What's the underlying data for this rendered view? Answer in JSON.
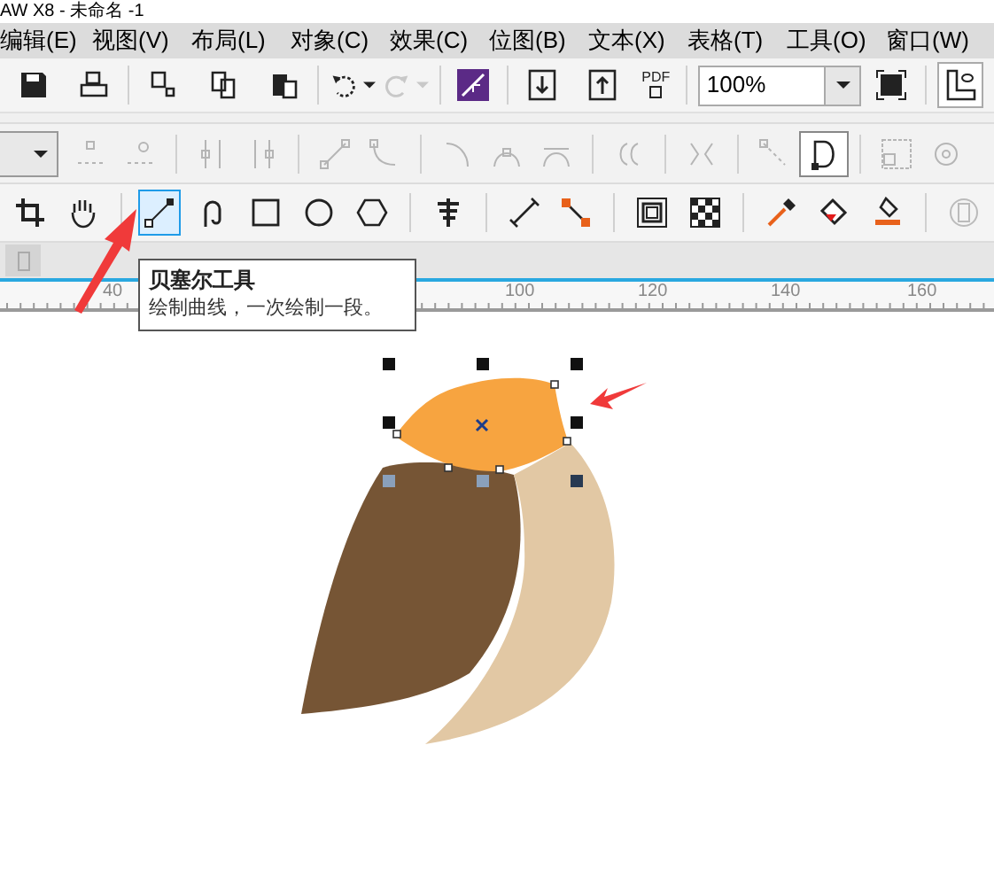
{
  "window": {
    "title": "AW X8 - 未命名 -1"
  },
  "menu": [
    "编辑(E)",
    "视图(V)",
    "布局(L)",
    "对象(C)",
    "效果(C)",
    "位图(B)",
    "文本(X)",
    "表格(T)",
    "工具(O)",
    "窗口(W)"
  ],
  "standard_toolbar": {
    "pdf_label": "PDF",
    "zoom": "100%",
    "redo_disabled": true
  },
  "property_bar": [
    {
      "selected": false
    },
    {
      "selected": false
    },
    {
      "selected": false
    },
    {
      "selected": false
    },
    {
      "selected": false
    },
    {
      "selected": false
    },
    {
      "selected": false
    },
    {
      "selected": false
    },
    {
      "selected": false
    },
    {
      "selected": false
    },
    {
      "selected": false
    },
    {
      "selected": false
    },
    {
      "selected": true
    },
    {
      "selected": false
    },
    {
      "selected": false
    }
  ],
  "toolbox": [
    {
      "selected": false
    },
    {
      "selected": false
    },
    {
      "selected": true
    },
    {
      "selected": false
    },
    {
      "selected": false
    },
    {
      "selected": false
    },
    {
      "selected": false
    },
    {
      "selected": false
    },
    {
      "selected": false
    },
    {
      "selected": false
    },
    {
      "selected": false
    },
    {
      "selected": false
    },
    {
      "selected": false
    },
    {
      "selected": false
    },
    {
      "selected": false
    },
    {
      "selected": false
    }
  ],
  "tooltip": {
    "title": "贝塞尔工具",
    "description": "绘制曲线，一次绘制一段。"
  },
  "ruler": [
    "40",
    "100",
    "120",
    "140",
    "160"
  ]
}
